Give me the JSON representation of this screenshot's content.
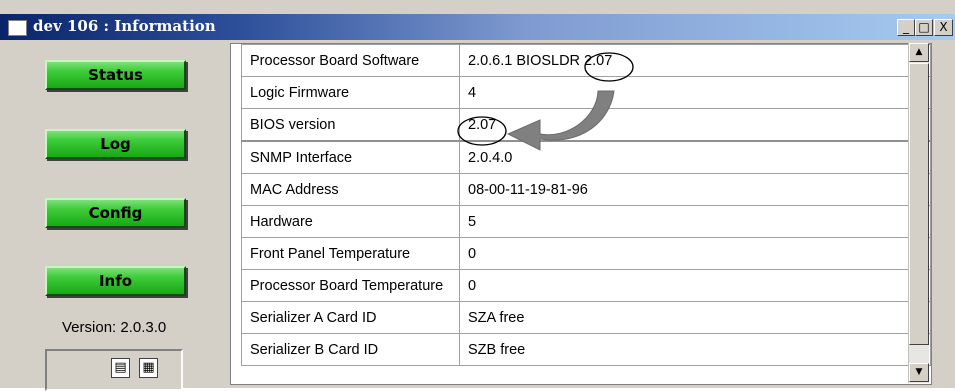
{
  "window": {
    "title": "dev 106 : Information",
    "minimize_label": "_",
    "maximize_label": "□",
    "close_label": "X"
  },
  "nav": {
    "buttons": [
      {
        "label": "Status"
      },
      {
        "label": "Log"
      },
      {
        "label": "Config"
      },
      {
        "label": "Info"
      }
    ],
    "version_text": "Version: 2.0.3.0",
    "view_icons": [
      "list-view-icon",
      "grid-view-icon"
    ]
  },
  "info_table": {
    "rows": [
      {
        "key": "Processor Board Software",
        "value": "2.0.6.1 BIOSLDR 2.07"
      },
      {
        "key": "Logic Firmware",
        "value": "4"
      },
      {
        "key": "BIOS version",
        "value": "2.07"
      },
      {
        "key": "SNMP Interface",
        "value": "2.0.4.0"
      },
      {
        "key": "MAC Address",
        "value": "08-00-11-19-81-96"
      },
      {
        "key": "Hardware",
        "value": "5"
      },
      {
        "key": "Front Panel Temperature",
        "value": "0"
      },
      {
        "key": "Processor Board Temperature",
        "value": "0"
      },
      {
        "key": "Serializer A Card ID",
        "value": "SZA free"
      },
      {
        "key": "Serializer B Card ID",
        "value": "SZB free"
      }
    ]
  },
  "scrollbar": {
    "up_icon": "▲",
    "down_icon": "▼"
  },
  "annotation": {
    "arrow": "curved-arrow-icon",
    "color": "#808080"
  }
}
